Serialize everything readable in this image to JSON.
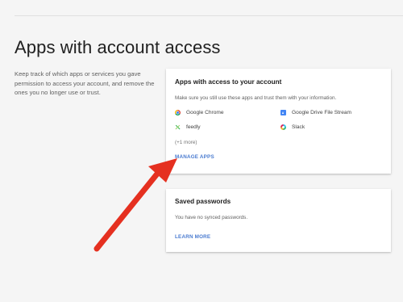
{
  "page": {
    "title": "Apps with account access",
    "intro": "Keep track of which apps or services you gave permission to access your account, and remove the ones you no longer use or trust."
  },
  "apps_card": {
    "title": "Apps with access to your account",
    "description": "Make sure you still use these apps and trust them with your information.",
    "apps": [
      {
        "name": "Google Chrome",
        "icon": "chrome-icon"
      },
      {
        "name": "Google Drive File Stream",
        "icon": "drive-icon"
      },
      {
        "name": "feedly",
        "icon": "feedly-icon"
      },
      {
        "name": "Slack",
        "icon": "slack-icon"
      }
    ],
    "more": "(+1 more)",
    "manage_label": "MANAGE APPS"
  },
  "passwords_card": {
    "title": "Saved passwords",
    "description": "You have no synced passwords.",
    "learn_label": "LEARN MORE"
  },
  "colors": {
    "background": "#f5f5f5",
    "link": "#4a7bd0",
    "annotation_arrow": "#e53020"
  }
}
